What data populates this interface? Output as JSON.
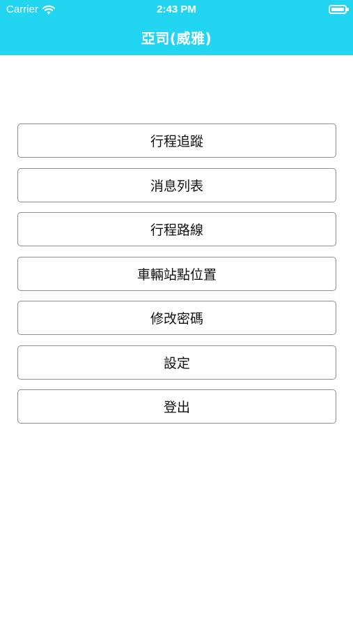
{
  "status_bar": {
    "carrier": "Carrier",
    "time": "2:43 PM",
    "wifi_icon": "wifi-icon",
    "battery_icon": "battery-icon"
  },
  "header": {
    "title": "亞司(威雅)",
    "background_color": "#22d6f2",
    "text_color": "#ffffff"
  },
  "menu": {
    "items": [
      {
        "label": "行程追蹤"
      },
      {
        "label": "消息列表"
      },
      {
        "label": "行程路線"
      },
      {
        "label": "車輛站點位置"
      },
      {
        "label": "修改密碼"
      },
      {
        "label": "設定"
      },
      {
        "label": "登出"
      }
    ]
  }
}
